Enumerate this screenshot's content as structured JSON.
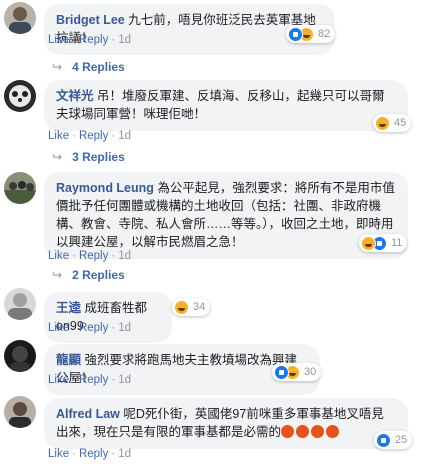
{
  "comments": [
    {
      "author": "Bridget Lee",
      "text": "九七前，唔見你班泛民去英軍基地抗議！",
      "actions": {
        "like": "Like",
        "reply": "Reply",
        "time": "1d"
      },
      "reaction_count": "82",
      "reaction_types": [
        "like",
        "haha"
      ],
      "replies_label": "4 Replies"
    },
    {
      "author": "文祥光",
      "text": "吊！堆廢反軍建、反填海、反移山，起幾只可以哥爾夫球場同軍營！咪理佢哋！",
      "actions": {
        "like": "Like",
        "reply": "Reply",
        "time": "1d"
      },
      "reaction_count": "45",
      "reaction_types": [
        "haha"
      ],
      "replies_label": "3 Replies"
    },
    {
      "author": "Raymond Leung",
      "text": "為公平起見，強烈要求：將所有不是用市值價批予任何團體或機構的土地收回（包括：社團、非政府機構、教會、寺院、私人會所……等等。），收回之土地，即時用以興建公屋，以解市民燃眉之急！",
      "actions": {
        "like": "Like",
        "reply": "Reply",
        "time": "1d"
      },
      "reaction_count": "11",
      "reaction_types": [
        "haha",
        "like"
      ],
      "replies_label": "2 Replies"
    },
    {
      "author": "王逵",
      "text": "成班畜牲都on99",
      "actions": {
        "like": "Like",
        "reply": "Reply",
        "time": "1d"
      },
      "reaction_count": "34",
      "reaction_types": [
        "haha"
      ]
    },
    {
      "author": "龍顯",
      "text": "強烈要求將跑馬地夫主教墳場改為興建公屋！",
      "actions": {
        "like": "Like",
        "reply": "Reply",
        "time": "1d"
      },
      "reaction_count": "30",
      "reaction_types": [
        "like",
        "haha"
      ]
    },
    {
      "author": "Alfred Law",
      "text": "呢D死仆街，英國佬97前咪重多軍事基地叉唔見出來，現在只是有限的軍事基都是必需的",
      "actions": {
        "like": "Like",
        "reply": "Reply",
        "time": "1d"
      },
      "reaction_count": "25",
      "reaction_types": [
        "like"
      ]
    }
  ],
  "colors": {
    "link": "#385898",
    "bubble": "#f2f3f5",
    "meta": "#90949c",
    "like_blue": "#1877f2",
    "haha_yellow": "#f7b125",
    "angry_orange": "#e9710f"
  },
  "icons": {
    "reply_arrow": "reply-arrow-icon",
    "like": "like-reaction-icon",
    "haha": "haha-reaction-icon",
    "angry": "angry-emoji-icon"
  }
}
